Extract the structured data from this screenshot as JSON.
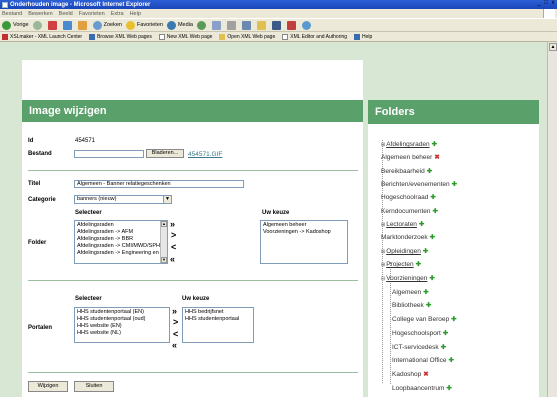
{
  "window": {
    "title": "Onderhouden image - Microsoft Internet Explorer",
    "controls": [
      "_",
      "□",
      "x"
    ]
  },
  "menu": [
    "Bestand",
    "Bewerken",
    "Beeld",
    "Favorieten",
    "Extra",
    "Help"
  ],
  "toolbar": {
    "back": "Vorige",
    "search": "Zoeken",
    "favorites": "Favorieten",
    "media": "Media"
  },
  "links": [
    "XSLmaker - XML Launch Center",
    "Browse XML Web pages",
    "New XML Web page",
    "Open XML Web page",
    "XML Editor and Authoring",
    "Help"
  ],
  "image_panel": {
    "heading": "Image wijzigen",
    "id_label": "Id",
    "id_value": "454571",
    "file_label": "Bestand",
    "browse_button": "Bladeren...",
    "file_link": "454571.GIF",
    "title_label": "Titel",
    "title_value": "Algemeen - Banner relatiegeschenken",
    "category_label": "Categorie",
    "category_value": "banners (nieuw)",
    "select_header": "Selecteer",
    "choice_header": "Uw keuze",
    "folder_label": "Folder",
    "folder_options": [
      "Afdelingsraden",
      "Afdelingsraden -> AFM",
      "Afdelingsraden -> BBR",
      "Afdelingsraden -> CMI/MWD/SPH/GEZ",
      "Afdelingsraden -> Engineering en TMD"
    ],
    "folder_choices": [
      "Algemeen beheer",
      "Voorzieningen -> Kadoshop"
    ],
    "portals_label": "Portalen",
    "portal_options": [
      "HHS studentenportaal (EN)",
      "HHS studentenportaal (oud)",
      "HHS website (EN)",
      "HHS website (NL)"
    ],
    "portal_choices": [
      "HHS bedrijfsnet",
      "HHS studentenportaal"
    ],
    "move_all_right": "»",
    "move_right": ">",
    "move_left": "<",
    "move_all_left": "«",
    "save_button": "Wijzigen",
    "close_button": "Sluiten"
  },
  "folders_panel": {
    "heading": "Folders",
    "expand_symbol": "⊞",
    "collapse_symbol": "⊟",
    "add_symbol": "✚",
    "remove_symbol": "✖",
    "items": [
      "Afdelingsraden",
      "Algemeen beheer",
      "Bereikbaarheid",
      "Berichten/evenementen",
      "Hogeschoolraad",
      "Kerndocumenten",
      "Lectoraten",
      "Marktonderzoek",
      "Opleidingen",
      "Projecten",
      "Voorzieningen",
      "Algemeen",
      "Bibliotheek",
      "College van Beroep",
      "Hogeschoolsport",
      "ICT-servicedesk",
      "International Office",
      "Kadoshop",
      "Loopbaancentrum"
    ]
  },
  "colors": {
    "panel_header": "#5aa06a",
    "page_background": "#d8e6d4",
    "link": "#3a7a8a",
    "add": "#2a9a2a",
    "remove": "#d03030"
  }
}
